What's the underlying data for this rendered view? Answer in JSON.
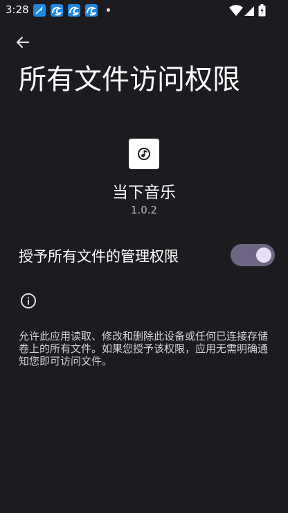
{
  "status_bar": {
    "time": "3:28",
    "notification_icons": [
      "feather-app-icon",
      "wave-app-icon",
      "wave-app-icon",
      "wave-app-icon"
    ],
    "system_icons": [
      "wifi-icon",
      "signal-icon",
      "battery-icon"
    ]
  },
  "header": {
    "back_icon": "arrow-left-icon",
    "title": "所有文件访问权限"
  },
  "app": {
    "icon": "music-note-icon",
    "name": "当下音乐",
    "version": "1.0.2"
  },
  "permission": {
    "label": "授予所有文件的管理权限",
    "enabled": true
  },
  "info": {
    "icon": "info-icon",
    "description": "允许此应用读取、修改和删除此设备或任何已连接存储卷上的所有文件。如果您授予该权限，应用无需明确通知您即可访问文件。"
  },
  "colors": {
    "background": "#1c1b1f",
    "switch_track": "#6e6682",
    "switch_thumb": "#e8def8",
    "notification_icon": "#1e88e5"
  }
}
